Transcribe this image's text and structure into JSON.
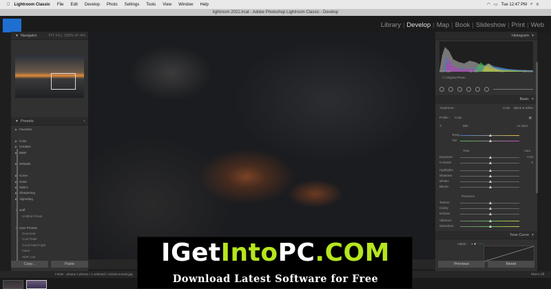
{
  "mac_menu": {
    "apple": "",
    "app_name": "Lightroom Classic",
    "items": [
      "File",
      "Edit",
      "Develop",
      "Photo",
      "Settings",
      "Tools",
      "View",
      "Window",
      "Help"
    ],
    "clock": "Tue 12:47 PM"
  },
  "window_title": "lightroom 2021.lrcat - Adobe Photoshop Lightroom Classic - Develop",
  "modules": [
    {
      "label": "Library",
      "active": false
    },
    {
      "label": "Develop",
      "active": true
    },
    {
      "label": "Map",
      "active": false
    },
    {
      "label": "Book",
      "active": false
    },
    {
      "label": "Slideshow",
      "active": false
    },
    {
      "label": "Print",
      "active": false
    },
    {
      "label": "Web",
      "active": false
    }
  ],
  "left_panel": {
    "navigator_title": "Navigator",
    "navigator_zoom": "FIT  FILL  100%  47.4%",
    "presets_title": "Presets",
    "presets_add": "+",
    "preset_items": [
      {
        "label": "Favorites",
        "sub": false
      },
      {
        "label": "",
        "sub": false
      },
      {
        "label": "Color",
        "sub": false
      },
      {
        "label": "Creative",
        "sub": false
      },
      {
        "label": "B&W",
        "sub": false
      },
      {
        "label": "",
        "sub": false
      },
      {
        "label": "Defaults",
        "sub": false
      },
      {
        "label": "",
        "sub": false
      },
      {
        "label": "Curve",
        "sub": false
      },
      {
        "label": "Grain",
        "sub": false
      },
      {
        "label": "Optics",
        "sub": false
      },
      {
        "label": "Sharpening",
        "sub": false
      },
      {
        "label": "Vignetting",
        "sub": false
      },
      {
        "label": "",
        "sub": false
      },
      {
        "label": "stuff",
        "sub": false
      },
      {
        "label": "Untitled Preset",
        "sub": true
      },
      {
        "label": "",
        "sub": false
      },
      {
        "label": "User Presets",
        "sub": false
      },
      {
        "label": "cloud pop",
        "sub": true
      },
      {
        "label": "Cool Flatte",
        "sub": true
      },
      {
        "label": "Good Giant Fight",
        "sub": true
      },
      {
        "label": "hdark",
        "sub": true
      },
      {
        "label": "HDR cool",
        "sub": true
      }
    ],
    "copy_label": "Copy...",
    "paste_label": "Paste"
  },
  "right_panel": {
    "histogram_title": "Histogram",
    "histo_info": [
      "ISO 400",
      "11 mm",
      "f / 8.0",
      "1/3 sec"
    ],
    "original_photo": "Original Photo",
    "basic_title": "Basic",
    "treatment_label": "Treatment :",
    "treatment_color": "Color",
    "treatment_bw": "Black & White",
    "profile_label": "Profile :",
    "profile_value": "Color",
    "wb_label": "WB :",
    "wb_value": "As Shot",
    "temp_label": "Temp",
    "tint_label": "Tint",
    "tone_label": "Tone",
    "tone_auto": "Auto",
    "exposure_label": "Exposure",
    "exposure_value": "0.00",
    "contrast_label": "Contrast",
    "contrast_value": "0",
    "highlights_label": "Highlights",
    "shadows_label": "Shadows",
    "whites_label": "Whites",
    "blacks_label": "Blacks",
    "presence_label": "Presence",
    "texture_label": "Texture",
    "clarity_label": "Clarity",
    "dehaze_label": "Dehaze",
    "vibrance_label": "Vibrance",
    "saturation_label": "Saturation",
    "tonecurve_title": "Tone Curve",
    "adjust_label": "Adjust :",
    "previous_label": "Previous",
    "reset_label": "Reset"
  },
  "filmstrip": {
    "info": "Folder : photos    2 photos / 1 selected / victoria sunset.jpg",
    "filter": "Filters Off"
  },
  "watermark": {
    "brand_white1": "IGet",
    "brand_green1": "Into",
    "brand_white2": "PC",
    "brand_green2": ".COM",
    "tagline": "Download Latest Software for Free"
  },
  "colors": {
    "lr_blue": "#1f6fd1",
    "watermark_green": "#b5e61d",
    "panel_bg": "#313131"
  }
}
